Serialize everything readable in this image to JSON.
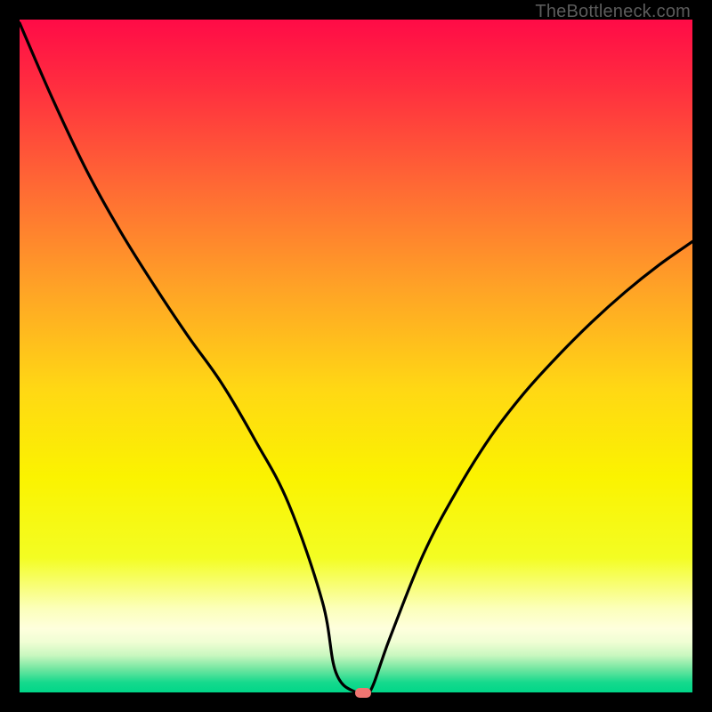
{
  "watermark": "TheBottleneck.com",
  "colors": {
    "bg": "#000000",
    "curve": "#000000",
    "marker": "#ef7571",
    "gradient_stops": [
      {
        "offset": 0.0,
        "color": "#ff0b47"
      },
      {
        "offset": 0.1,
        "color": "#ff2e3f"
      },
      {
        "offset": 0.25,
        "color": "#ff6a34"
      },
      {
        "offset": 0.4,
        "color": "#ffa326"
      },
      {
        "offset": 0.55,
        "color": "#ffd814"
      },
      {
        "offset": 0.68,
        "color": "#fbf300"
      },
      {
        "offset": 0.8,
        "color": "#f3fd23"
      },
      {
        "offset": 0.875,
        "color": "#fcffba"
      },
      {
        "offset": 0.905,
        "color": "#feffdd"
      },
      {
        "offset": 0.925,
        "color": "#f0fed4"
      },
      {
        "offset": 0.945,
        "color": "#c9f7bf"
      },
      {
        "offset": 0.965,
        "color": "#72e6a1"
      },
      {
        "offset": 0.985,
        "color": "#16d98d"
      },
      {
        "offset": 1.0,
        "color": "#00d688"
      }
    ]
  },
  "chart_data": {
    "type": "line",
    "x": [
      0.0,
      0.05,
      0.1,
      0.15,
      0.2,
      0.25,
      0.3,
      0.35,
      0.4,
      0.45,
      0.47,
      0.5,
      0.52,
      0.55,
      0.6,
      0.65,
      0.7,
      0.75,
      0.8,
      0.85,
      0.9,
      0.95,
      1.0
    ],
    "values": [
      99.5,
      88.0,
      77.5,
      68.5,
      60.5,
      53.0,
      46.0,
      37.5,
      28.0,
      13.5,
      3.0,
      0.0,
      0.0,
      8.0,
      20.5,
      30.0,
      38.0,
      44.5,
      50.0,
      55.0,
      59.5,
      63.5,
      67.0
    ],
    "title": "",
    "xlabel": "",
    "ylabel": "",
    "xlim": [
      0,
      1
    ],
    "ylim": [
      0,
      100
    ],
    "marker": {
      "x": 0.51,
      "y": 0.0
    }
  }
}
